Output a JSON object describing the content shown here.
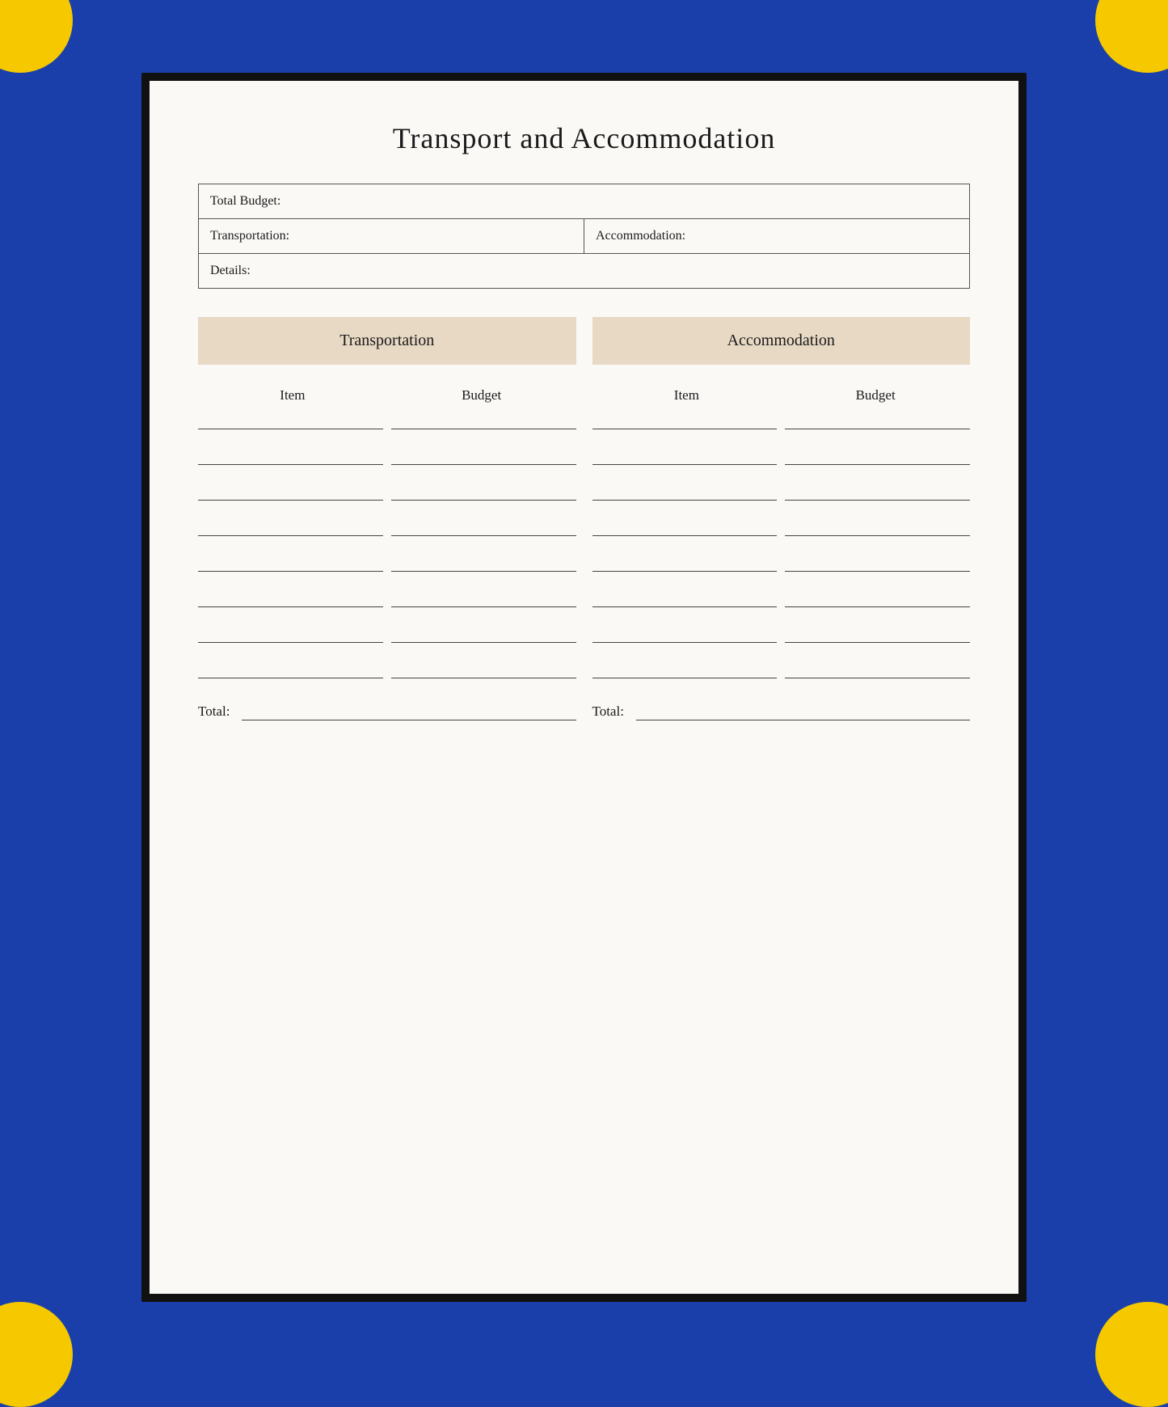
{
  "page": {
    "background_color": "#1a3faa",
    "title": "Transport and Accommodation"
  },
  "summary": {
    "total_budget_label": "Total Budget:",
    "transportation_label": "Transportation:",
    "accommodation_label": "Accommodation:",
    "details_label": "Details:"
  },
  "sections": {
    "transportation_btn": "Transportation",
    "accommodation_btn": "Accommodation"
  },
  "columns": {
    "item_label": "Item",
    "budget_label": "Budget",
    "item2_label": "Item",
    "budget2_label": "Budget"
  },
  "totals": {
    "total1_label": "Total:",
    "total2_label": "Total:"
  },
  "num_rows": 8
}
